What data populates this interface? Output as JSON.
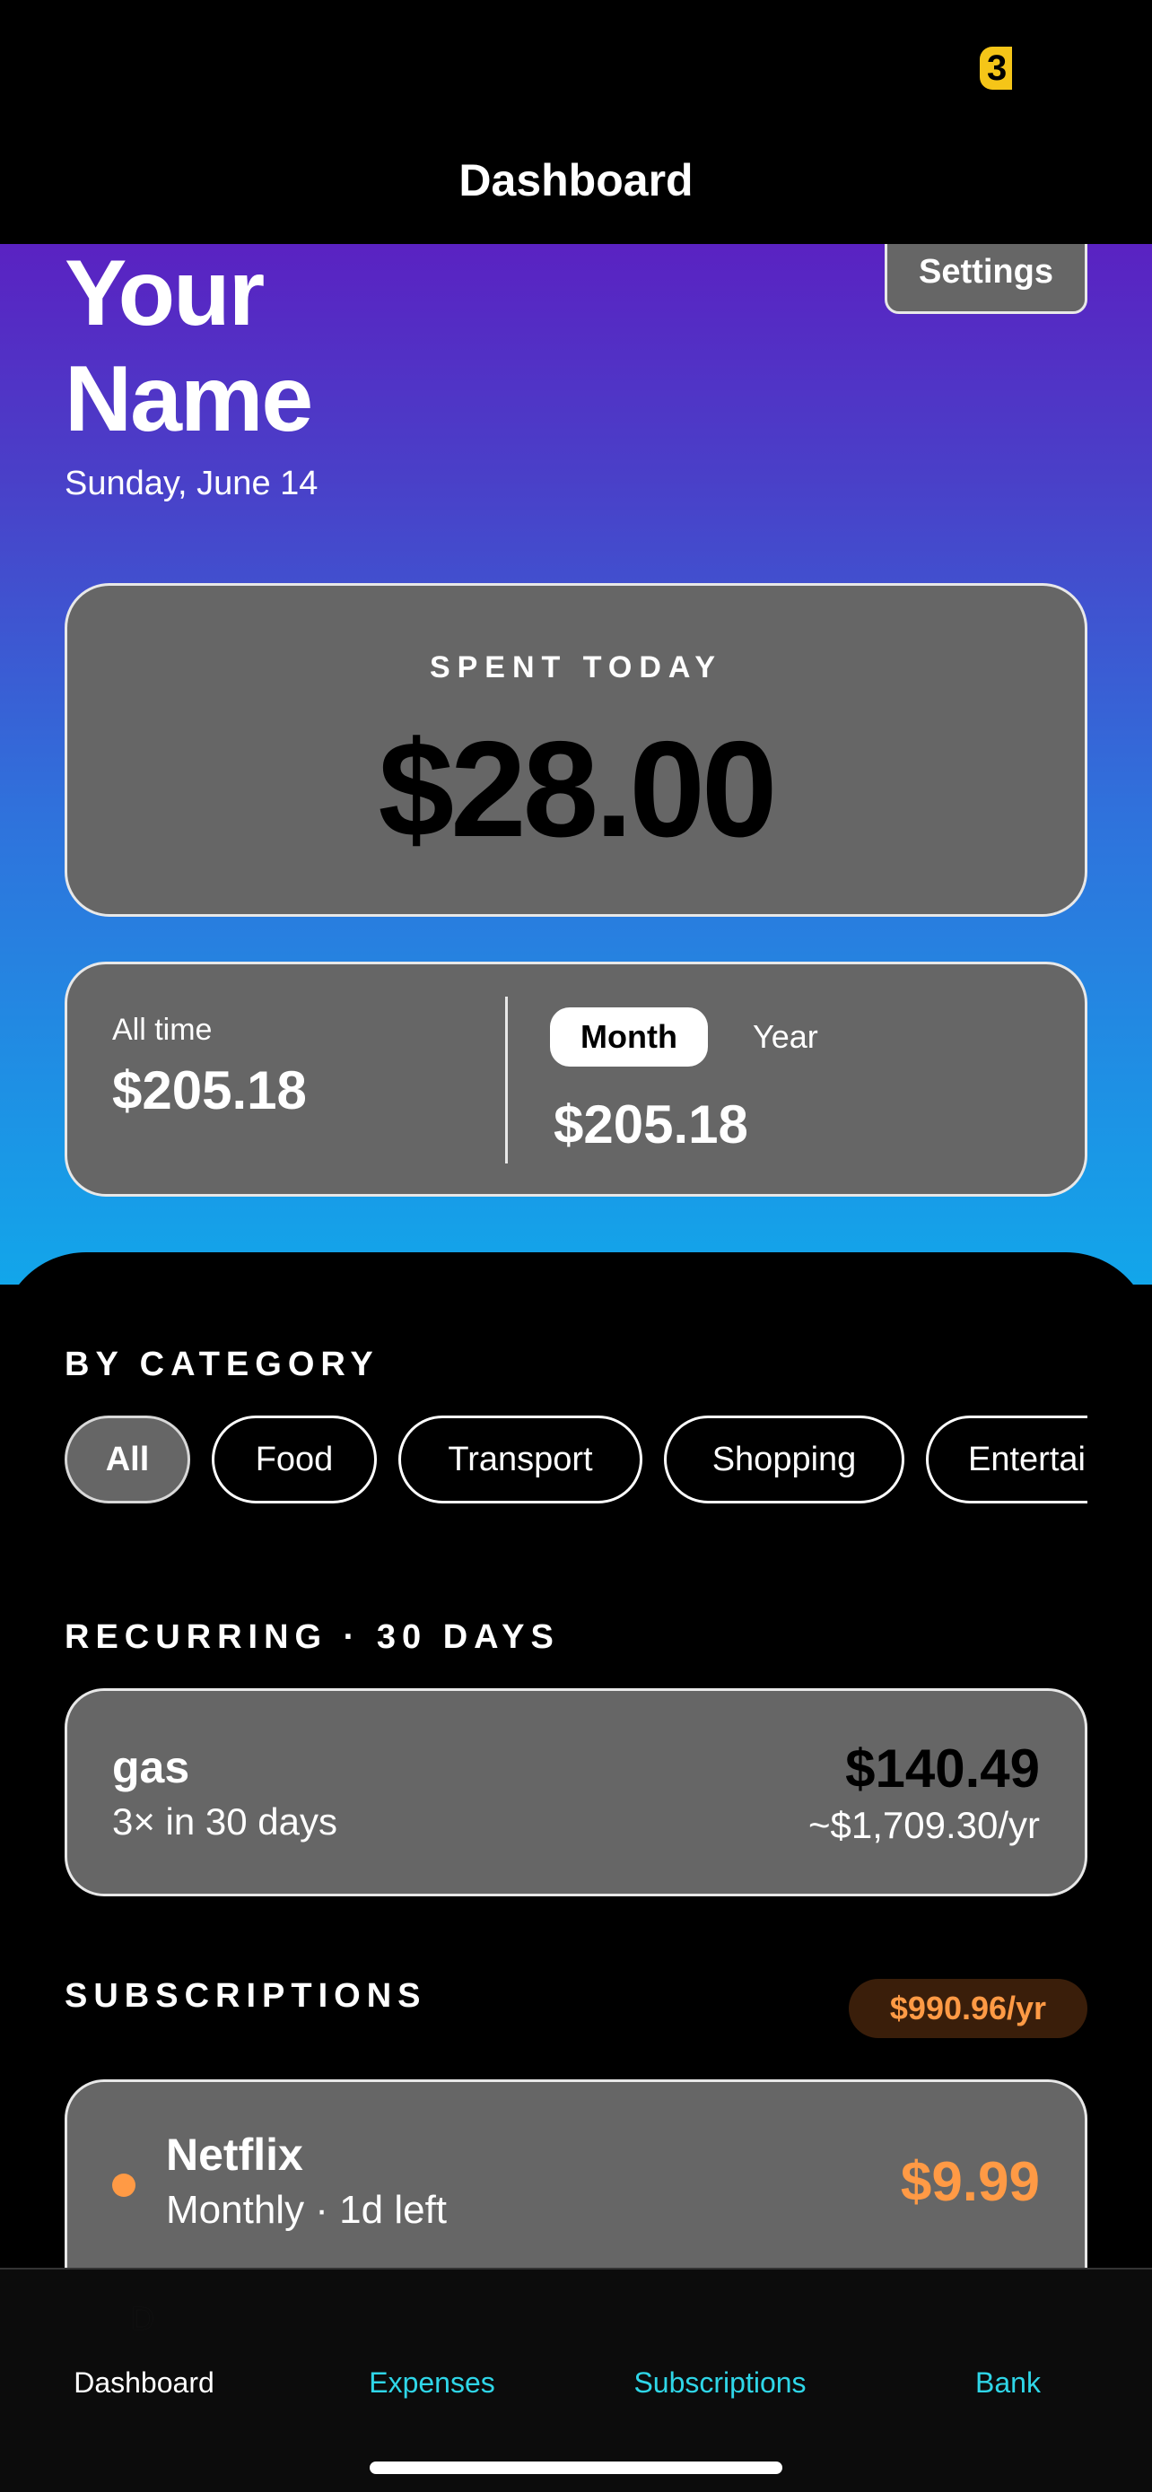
{
  "status": {
    "badge_text": "3"
  },
  "nav": {
    "title": "Dashboard",
    "settings_label": "Settings"
  },
  "header": {
    "user_name_line1": "Your",
    "user_name_line2": "Name",
    "date": "Sunday, June 14"
  },
  "spent_today": {
    "label": "SPENT TODAY",
    "amount": "$28.00"
  },
  "totals": {
    "all_time_label": "All time",
    "all_time_value": "$205.18",
    "period_tabs": [
      {
        "label": "Month",
        "selected": true
      },
      {
        "label": "Year",
        "selected": false
      }
    ],
    "period_value": "$205.18"
  },
  "by_category": {
    "title": "BY CATEGORY",
    "chips": [
      {
        "label": "All",
        "selected": true
      },
      {
        "label": "Food",
        "selected": false
      },
      {
        "label": "Transport",
        "selected": false
      },
      {
        "label": "Shopping",
        "selected": false
      },
      {
        "label": "Entertainment",
        "selected": false
      }
    ]
  },
  "recurring": {
    "title": "RECURRING · 30 DAYS",
    "items": [
      {
        "name": "gas",
        "count": "3× in 30 days",
        "amount": "$140.49",
        "annual": "~$1,709.30/yr"
      }
    ]
  },
  "subscriptions": {
    "title": "SUBSCRIPTIONS",
    "annual_total": "$990.96/yr",
    "items": [
      {
        "name": "Netflix",
        "meta": "Monthly · 1d left",
        "price": "$9.99"
      }
    ]
  },
  "tabbar": {
    "placeholder_glyph": "D",
    "items": [
      {
        "label": "Dashboard",
        "active": true
      },
      {
        "label": "Expenses",
        "active": false
      },
      {
        "label": "Subscriptions",
        "active": false
      },
      {
        "label": "Bank",
        "active": false
      }
    ]
  },
  "colors": {
    "accent_cyan": "#2fd6e8",
    "subscription_orange": "#ff9a45",
    "card_gray": "#666666",
    "badge_yellow": "#f5c518"
  }
}
